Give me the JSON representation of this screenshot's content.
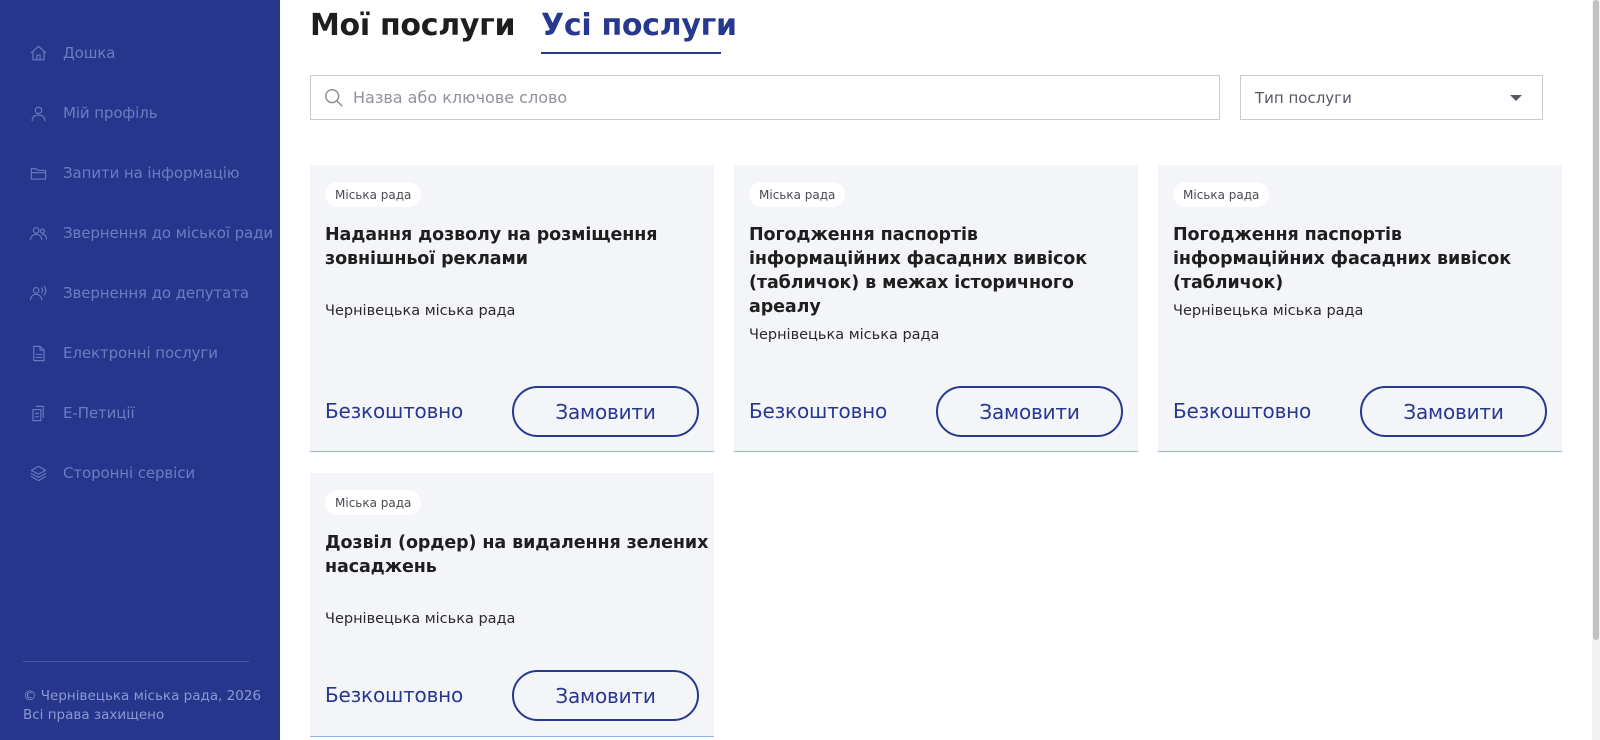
{
  "sidebar": {
    "items": [
      {
        "label": "Дошка",
        "icon": "home-icon"
      },
      {
        "label": "Мій профіль",
        "icon": "user-icon"
      },
      {
        "label": "Запити на інформацію",
        "icon": "folder-icon"
      },
      {
        "label": "Звернення до міської ради",
        "icon": "users-icon"
      },
      {
        "label": "Звернення до депутата",
        "icon": "user-voice-icon"
      },
      {
        "label": "Електронні послуги",
        "icon": "document-icon"
      },
      {
        "label": "Е-Петиції",
        "icon": "petition-icon"
      },
      {
        "label": "Сторонні сервіси",
        "icon": "layers-icon"
      }
    ],
    "copyright_line1": "© Чернівецька міська рада, 2026",
    "copyright_line2": "Всі права захищено"
  },
  "tabs": {
    "mine": "Мої послуги",
    "all": "Усі послуги",
    "active": "all"
  },
  "search": {
    "placeholder": "Назва або ключове слово",
    "value": ""
  },
  "filter": {
    "label": "Тип послуги"
  },
  "cards": [
    {
      "tag": "Міська рада",
      "title": "Надання дозволу на розміщення зовнішньої реклами",
      "org": "Чернівецька міська рада",
      "price": "Безкоштовно",
      "button": "Замовити"
    },
    {
      "tag": "Міська рада",
      "title": "Погодження паспортів інформаційних фасадних вивісок (табличок) в межах історичного ареалу",
      "org": "Чернівецька міська рада",
      "price": "Безкоштовно",
      "button": "Замовити"
    },
    {
      "tag": "Міська рада",
      "title": "Погодження паспортів інформаційних фасадних вивісок (табличок)",
      "org": "Чернівецька міська рада",
      "price": "Безкоштовно",
      "button": "Замовити"
    },
    {
      "tag": "Міська рада",
      "title": "Дозвіл (ордер) на видалення зелених насаджень",
      "org": "Чернівецька міська рада",
      "price": "Безкоштовно",
      "button": "Замовити"
    }
  ],
  "colors": {
    "sidebar_bg": "#26368c",
    "accent": "#27388f",
    "card_bg": "#f4f5f9"
  }
}
